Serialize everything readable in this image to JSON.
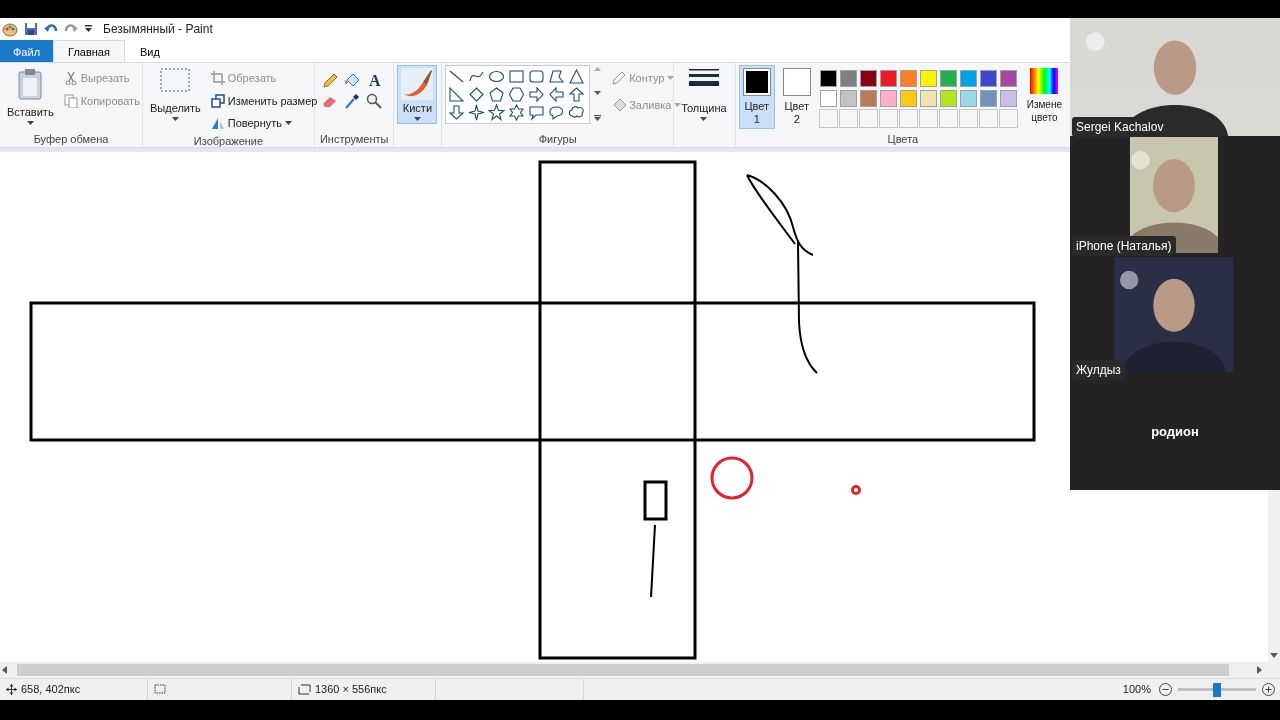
{
  "window": {
    "title": "Безымянный - Paint"
  },
  "tabs": [
    {
      "label": "Файл",
      "kind": "file",
      "selected": false
    },
    {
      "label": "Главная",
      "kind": "tab",
      "selected": true
    },
    {
      "label": "Вид",
      "kind": "tab",
      "selected": false
    }
  ],
  "clipboard": {
    "label": "Буфер обмена",
    "paste": "Вставить",
    "items": [
      {
        "label": "Вырезать",
        "kind": "cut",
        "disabled": true
      },
      {
        "label": "Копировать",
        "kind": "copy",
        "disabled": true
      }
    ]
  },
  "image": {
    "label": "Изображение",
    "select": "Выделить",
    "items": [
      {
        "label": "Обрезать",
        "kind": "crop",
        "disabled": true
      },
      {
        "label": "Изменить размер",
        "kind": "resize",
        "disabled": false
      },
      {
        "label": "Повернуть",
        "kind": "rotate",
        "disabled": false
      }
    ]
  },
  "tools": {
    "label": "Инструменты",
    "text_tool": "A"
  },
  "brushes": {
    "label": "Кисти",
    "selected": true
  },
  "shapes": {
    "label": "Фигуры",
    "outline": {
      "label": "Контур",
      "disabled": true
    },
    "fill": {
      "label": "Заливка",
      "disabled": true
    }
  },
  "size": {
    "label": "Толщина"
  },
  "colors": {
    "label": "Цвета",
    "color1": {
      "label": "Цвет",
      "index": "1",
      "color": "#000000",
      "selected": true
    },
    "color2": {
      "label": "Цвет",
      "index": "2",
      "color": "#ffffff",
      "selected": false
    },
    "palette": [
      {
        "color": "#000000"
      },
      {
        "color": "#7f7f7f"
      },
      {
        "color": "#880015"
      },
      {
        "color": "#ed1c24"
      },
      {
        "color": "#ff7f27"
      },
      {
        "color": "#fff200"
      },
      {
        "color": "#22b14c"
      },
      {
        "color": "#00a2e8"
      },
      {
        "color": "#3f48cc"
      },
      {
        "color": "#a349a4"
      },
      {
        "color": "#ffffff"
      },
      {
        "color": "#c3c3c3"
      },
      {
        "color": "#b97a57"
      },
      {
        "color": "#ffaec9"
      },
      {
        "color": "#ffc90e"
      },
      {
        "color": "#efe4b0"
      },
      {
        "color": "#b5e61d"
      },
      {
        "color": "#99d9ea"
      },
      {
        "color": "#7092be"
      },
      {
        "color": "#c8bfe7"
      }
    ],
    "edit": "Измене цвето"
  },
  "status_bar": {
    "position": "658, 402пкс",
    "size": "1360 × 556пкс",
    "zoom": {
      "reading": "100%",
      "level": 0.5
    }
  },
  "participants": [
    {
      "name": "Sergei Kachalov",
      "kind": "video"
    },
    {
      "name": "iPhone (Наталья)",
      "kind": "video"
    },
    {
      "name": "Жулдыз",
      "kind": "video"
    },
    {
      "name": "родион",
      "kind": "name"
    }
  ]
}
